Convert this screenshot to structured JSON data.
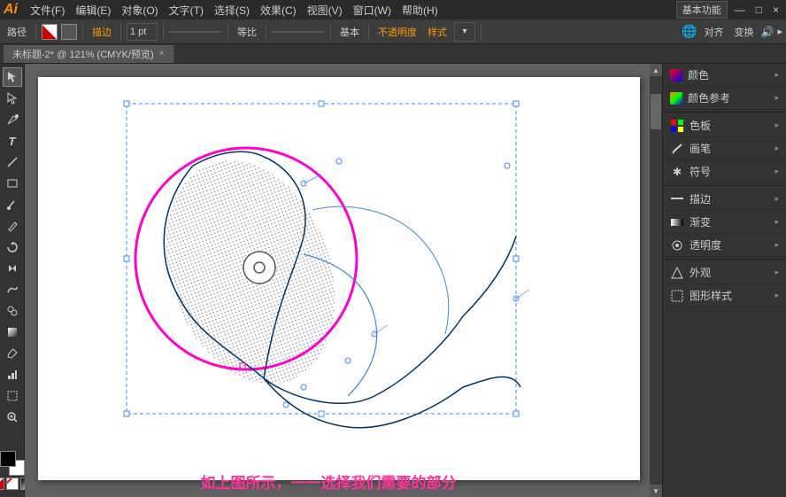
{
  "app": {
    "logo": "Ai",
    "title": "未标题-2* @ 121% (CMYK/预览)",
    "mode": "基本功能"
  },
  "menubar": {
    "items": [
      "文件(F)",
      "编辑(E)",
      "对象(O)",
      "文字(T)",
      "选择(S)",
      "效果(C)",
      "视图(V)",
      "窗口(W)",
      "帮助(H)"
    ]
  },
  "toolbar": {
    "path_label": "路径",
    "stroke_label": "描边",
    "pt_value": "1 pt",
    "ratio_label": "等比",
    "base_label": "基本",
    "opacity_label": "不透明度",
    "style_label": "样式",
    "align_label": "对齐",
    "transform_label": "变换"
  },
  "tab": {
    "title": "未标题-2* @ 121% (CMYK/预览)",
    "close": "×"
  },
  "right_panel": {
    "items": [
      {
        "icon": "🎨",
        "label": "颜色",
        "expandable": true
      },
      {
        "icon": "🎨",
        "label": "颜色参考",
        "expandable": true
      },
      {
        "icon": "▦",
        "label": "色板",
        "expandable": true
      },
      {
        "icon": "✏️",
        "label": "画笔",
        "expandable": true
      },
      {
        "icon": "✱",
        "label": "符号",
        "expandable": true
      },
      {
        "icon": "—",
        "label": "描边",
        "expandable": true
      },
      {
        "icon": "▭",
        "label": "渐变",
        "expandable": true
      },
      {
        "icon": "◎",
        "label": "透明度",
        "expandable": true
      },
      {
        "icon": "◈",
        "label": "外观",
        "expandable": true
      },
      {
        "icon": "⊡",
        "label": "图形样式",
        "expandable": true
      }
    ]
  },
  "caption": {
    "text": "如上图所示，一一选择我们需要的部分"
  },
  "colors": {
    "accent": "#ff3399",
    "stroke_blue": "#4488ff",
    "circle_magenta": "#ff00cc",
    "selection_blue": "#4488ff"
  }
}
